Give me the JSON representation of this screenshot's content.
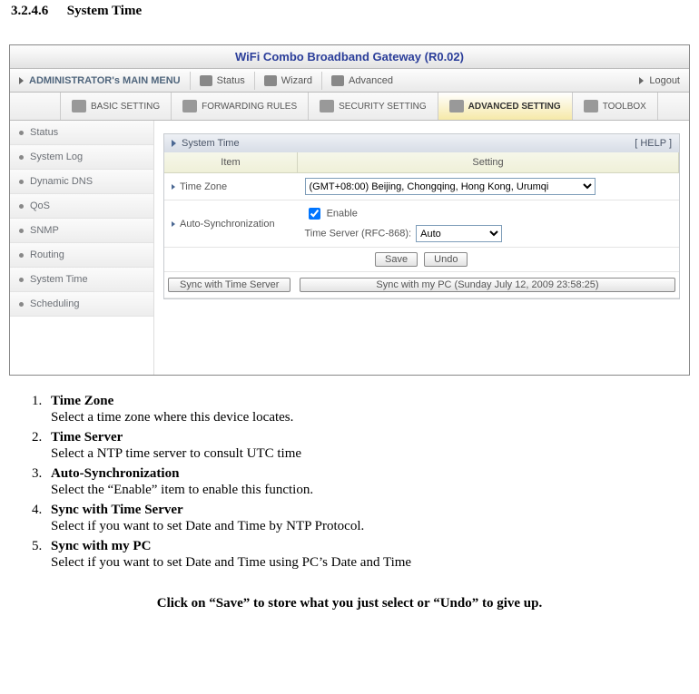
{
  "heading": {
    "number": "3.2.4.6",
    "title": "System Time"
  },
  "titlebar": "WiFi Combo Broadband Gateway (R0.02)",
  "mainmenu": {
    "admin": "ADMINISTRATOR's MAIN MENU",
    "status": "Status",
    "wizard": "Wizard",
    "advanced": "Advanced",
    "logout": "Logout"
  },
  "tabs": {
    "basic": "BASIC SETTING",
    "forward": "FORWARDING RULES",
    "security": "SECURITY SETTING",
    "advanced": "ADVANCED SETTING",
    "toolbox": "TOOLBOX"
  },
  "sidebar": {
    "items": [
      {
        "label": "Status"
      },
      {
        "label": "System Log"
      },
      {
        "label": "Dynamic DNS"
      },
      {
        "label": "QoS"
      },
      {
        "label": "SNMP"
      },
      {
        "label": "Routing"
      },
      {
        "label": "System Time"
      },
      {
        "label": "Scheduling"
      }
    ]
  },
  "panel": {
    "title": "System Time",
    "help": "[ HELP ]",
    "cols": {
      "item": "Item",
      "setting": "Setting"
    },
    "rows": {
      "tz_label": "Time Zone",
      "tz_value": "(GMT+08:00) Beijing, Chongqing, Hong Kong, Urumqi",
      "autosync_label": "Auto-Synchronization",
      "autosync_enable": "Enable",
      "autosync_server_label": "Time Server (RFC-868):",
      "autosync_server_value": "Auto"
    },
    "buttons": {
      "save": "Save",
      "undo": "Undo",
      "sync_server": "Sync with Time Server",
      "sync_pc": "Sync with my PC (Sunday July 12, 2009 23:58:25)"
    }
  },
  "explanation": {
    "items": [
      {
        "term": "Time Zone",
        "desc": "Select a time zone where this device locates."
      },
      {
        "term": "Time Server",
        "desc": "Select a NTP time server to consult UTC time"
      },
      {
        "term": "Auto-Synchronization",
        "desc": "Select the “Enable” item to enable this function."
      },
      {
        "term": "Sync with Time Server",
        "desc": "Select if you want to set Date and Time by NTP Protocol."
      },
      {
        "term": "Sync with my PC",
        "desc": "Select if you want to set Date and Time using PC’s Date and Time"
      }
    ],
    "footer": "Click on “Save” to store what you just select or “Undo” to give up."
  }
}
